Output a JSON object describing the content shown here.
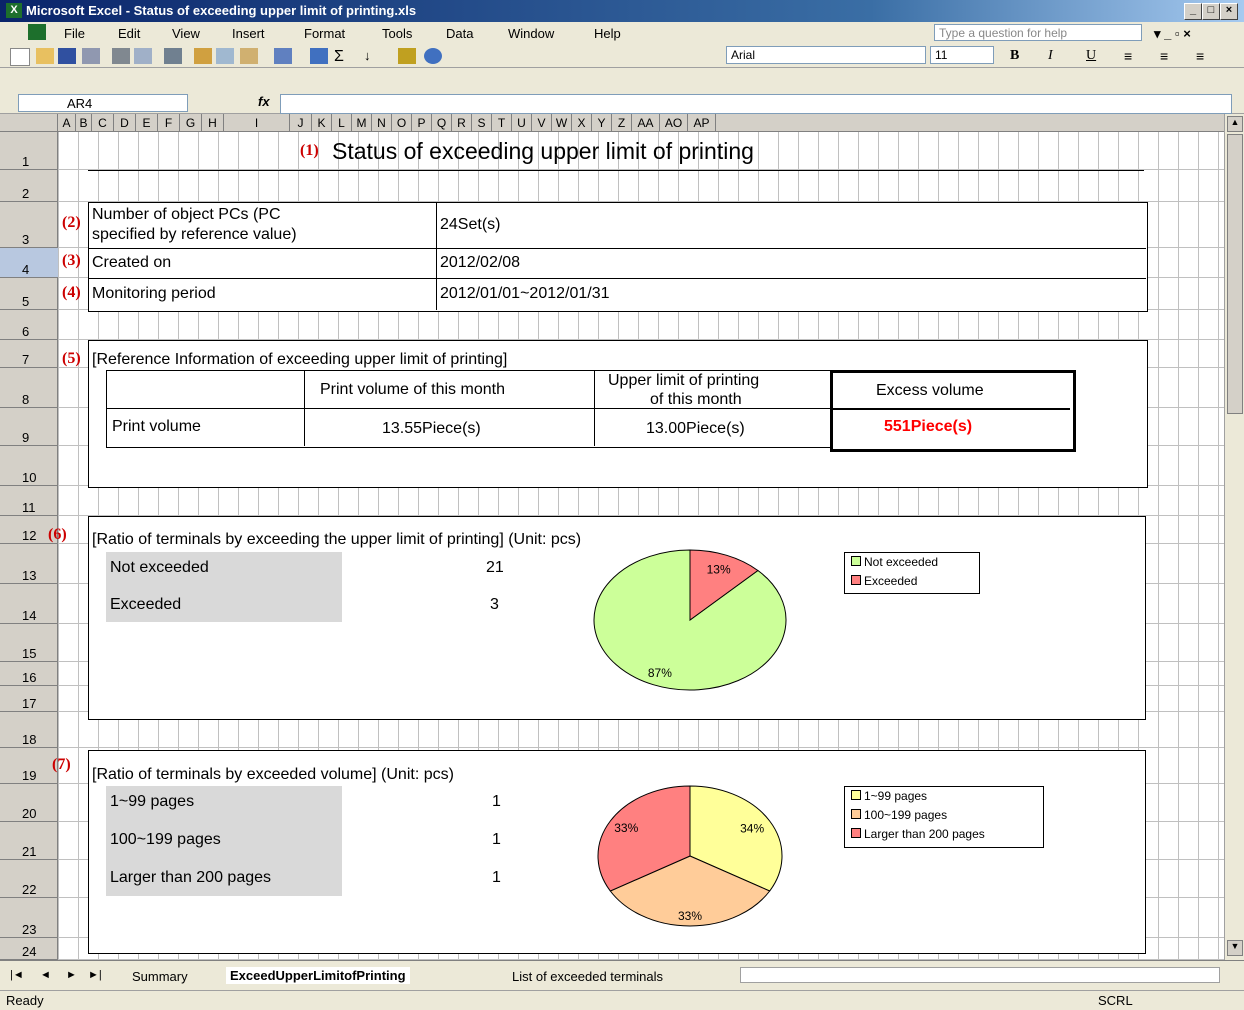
{
  "window": {
    "title": "Microsoft Excel - Status of exceeding upper limit of printing.xls",
    "app_icon": "X"
  },
  "menu": [
    "File",
    "Edit",
    "View",
    "Insert",
    "Format",
    "Tools",
    "Data",
    "Window",
    "Help"
  ],
  "help_placeholder": "Type a question for help",
  "toolbar": {
    "font": "Arial",
    "size": "11",
    "bold": "B",
    "italic": "I",
    "underline": "U"
  },
  "formula": {
    "name_box": "AR4",
    "fx": "fx"
  },
  "columns": [
    "A",
    "B",
    "C",
    "D",
    "E",
    "F",
    "G",
    "H",
    "I",
    "J",
    "K",
    "L",
    "M",
    "N",
    "O",
    "P",
    "Q",
    "R",
    "S",
    "T",
    "U",
    "V",
    "W",
    "X",
    "Y",
    "Z",
    "AA",
    "AO",
    "AP"
  ],
  "rows": [
    "1",
    "2",
    "3",
    "4",
    "5",
    "6",
    "7",
    "8",
    "9",
    "10",
    "11",
    "12",
    "13",
    "14",
    "15",
    "16",
    "17",
    "18",
    "19",
    "20",
    "21",
    "22",
    "23",
    "24"
  ],
  "sheet": {
    "title_num": "(1)",
    "title": "Status of exceeding upper limit of printing",
    "s2_num": "(2)",
    "s2_label_1": "Number of object PCs (PC",
    "s2_label_2": "specified by reference value)",
    "s2_value": "24Set(s)",
    "s3_num": "(3)",
    "s3_label": "Created on",
    "s3_value": "2012/02/08",
    "s4_num": "(4)",
    "s4_label": "Monitoring period",
    "s4_value": "2012/01/01~2012/01/31",
    "s5_num": "(5)",
    "s5_title": "[Reference Information of exceeding upper limit of printing]",
    "ref_headers": [
      "Print volume of this month",
      "Upper limit of printing",
      "of this month",
      "Excess volume"
    ],
    "ref_row_label": "Print volume",
    "ref_print_volume": "13.55Piece(s)",
    "ref_upper_limit": "13.00Piece(s)",
    "ref_excess": "551Piece(s)",
    "s6_num": "(6)",
    "s6_title": "[Ratio of terminals by exceeding the upper limit of printing] (Unit: pcs)",
    "s6_rows": [
      {
        "label": "Not exceeded",
        "value": "21"
      },
      {
        "label": "Exceeded",
        "value": "3"
      }
    ],
    "s7_num": "(7)",
    "s7_title": "[Ratio of terminals by exceeded volume] (Unit: pcs)",
    "s7_rows": [
      {
        "label": "1~99 pages",
        "value": "1"
      },
      {
        "label": "100~199 pages",
        "value": "1"
      },
      {
        "label": "Larger than 200 pages",
        "value": "1"
      }
    ]
  },
  "chart_data": [
    {
      "type": "pie",
      "categories": [
        "Not exceeded",
        "Exceeded"
      ],
      "values": [
        21,
        3
      ],
      "labels": [
        "87%",
        "13%"
      ],
      "colors": [
        "#ccff99",
        "#ff8080"
      ],
      "legend": "top-right"
    },
    {
      "type": "pie",
      "categories": [
        "1~99 pages",
        "100~199 pages",
        "Larger than 200 pages"
      ],
      "values": [
        1,
        1,
        1
      ],
      "labels": [
        "34%",
        "33%",
        "33%"
      ],
      "colors": [
        "#ffff99",
        "#ffcc99",
        "#ff8080"
      ],
      "legend": "top-right"
    }
  ],
  "tabs": [
    "Summary",
    "ExceedUpperLimitofPrinting",
    "List of exceeded terminals"
  ],
  "status": {
    "left": "Ready",
    "right": "SCRL"
  }
}
